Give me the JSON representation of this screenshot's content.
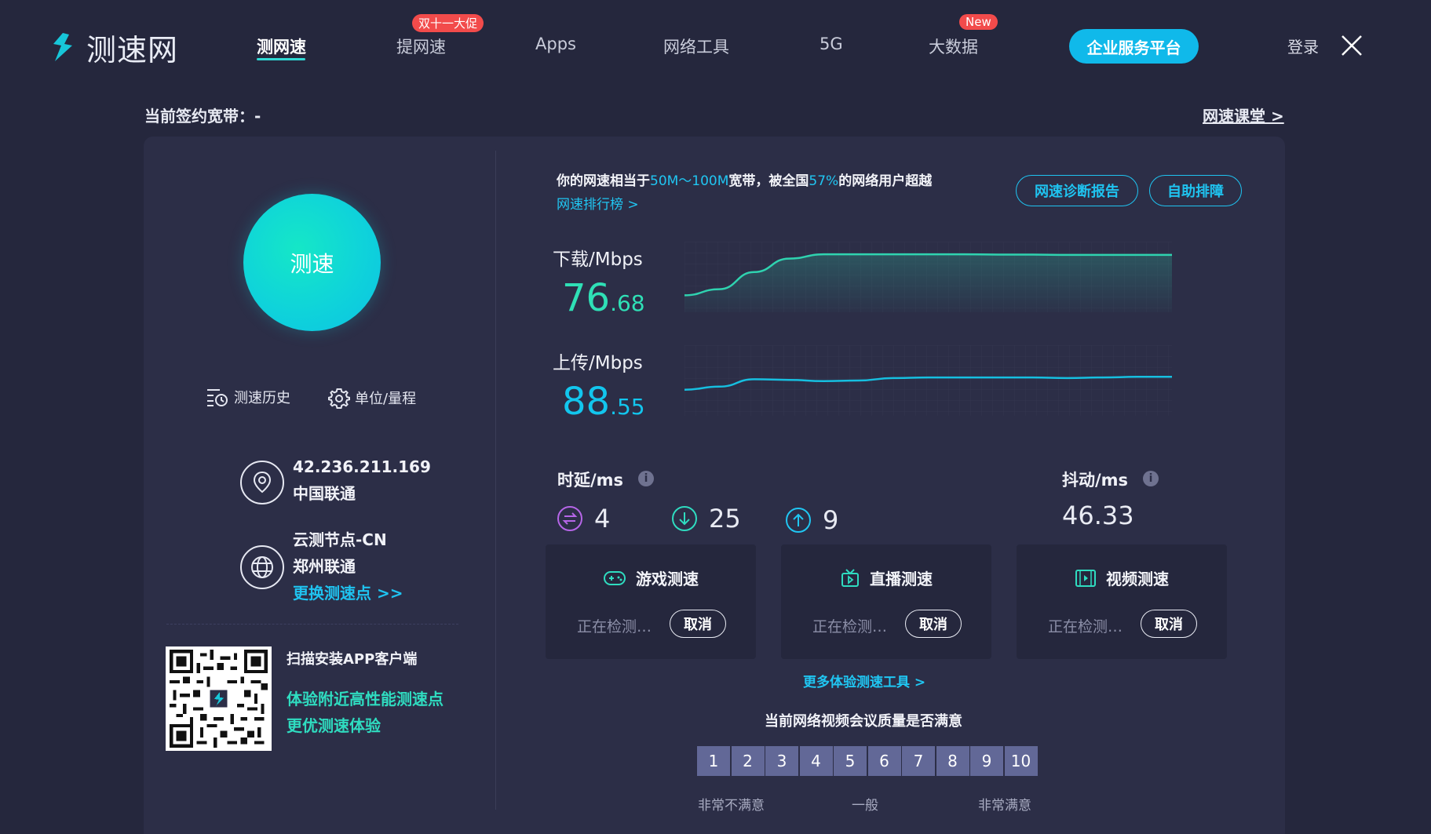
{
  "header": {
    "logo_text": "测速网",
    "nav": [
      {
        "label": "测网速",
        "active": true
      },
      {
        "label": "提网速",
        "badge": "双十一大促"
      },
      {
        "label": "Apps"
      },
      {
        "label": "网络工具"
      },
      {
        "label": "5G"
      },
      {
        "label": "大数据",
        "badge": "New"
      }
    ],
    "cta_label": "企业服务平台",
    "login_label": "登录"
  },
  "subheader": {
    "bandwidth_label": "当前签约宽带：-",
    "lesson_link": "网速课堂 >"
  },
  "left": {
    "go_button": "测速",
    "history_label": "测速历史",
    "units_label": "单位/量程",
    "ip": "42.236.211.169",
    "isp": "中国联通",
    "node_name": "云测节点-CN",
    "node_isp": "郑州联通",
    "change_node": "更换测速点 >>",
    "qr_title": "扫描安装APP客户端",
    "qr_line1": "体验附近高性能测速点",
    "qr_line2": "更优测速体验"
  },
  "summary": {
    "prefix": "你的网速相当于",
    "equivalent": "50M～100M",
    "middle": "宽带，被全国",
    "percent": "57%",
    "suffix": "的网络用户超越",
    "rank_link": "网速排行榜 >",
    "report_btn": "网速诊断报告",
    "troubleshoot_btn": "自助排障"
  },
  "speeds": {
    "download_label": "下载/Mbps",
    "download_int": "76",
    "download_dec": ".68",
    "upload_label": "上传/Mbps",
    "upload_int": "88",
    "upload_dec": ".55"
  },
  "chart_data": [
    {
      "type": "area",
      "title": "下载/Mbps",
      "x": [
        0,
        1,
        2,
        3,
        4,
        5,
        6,
        7,
        8,
        9,
        10,
        11,
        12,
        13,
        14
      ],
      "values": [
        20,
        30,
        58,
        80,
        87,
        87,
        87,
        87,
        87,
        86.5,
        86.5,
        86,
        86,
        86,
        86
      ]
    },
    {
      "type": "line",
      "title": "上传/Mbps",
      "x": [
        0,
        1,
        2,
        3,
        4,
        5,
        6,
        7,
        8,
        9,
        10,
        11,
        12,
        13,
        14
      ],
      "values": [
        35,
        40,
        52,
        51,
        49,
        50,
        54,
        55,
        55,
        55,
        55,
        54,
        55,
        56,
        56
      ]
    }
  ],
  "metrics": {
    "latency_label": "时延/ms",
    "ping": "4",
    "download_latency": "25",
    "upload_latency": "9",
    "jitter_label": "抖动/ms",
    "jitter": "46.33",
    "info_glyph": "i"
  },
  "cards": [
    {
      "title": "游戏测速",
      "status": "正在检测…",
      "cancel": "取消"
    },
    {
      "title": "直播测速",
      "status": "正在检测…",
      "cancel": "取消"
    },
    {
      "title": "视频测速",
      "status": "正在检测…",
      "cancel": "取消"
    }
  ],
  "more_tools": "更多体验测速工具 >",
  "survey": {
    "question": "当前网络视频会议质量是否满意",
    "options": [
      "1",
      "2",
      "3",
      "4",
      "5",
      "6",
      "7",
      "8",
      "9",
      "10"
    ],
    "low_label": "非常不满意",
    "mid_label": "一般",
    "high_label": "非常满意"
  },
  "colors": {
    "background": "#25273d",
    "panel": "#2c2e47",
    "accent_cyan": "#20c6f2",
    "accent_green": "#2fdcc0",
    "download_value": "#2fe0b6",
    "upload_value": "#12c6ee",
    "badge_red": "#f24b4b"
  }
}
